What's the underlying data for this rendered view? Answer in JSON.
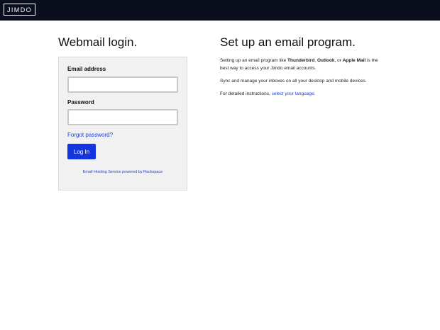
{
  "header": {
    "logo_text": "JIMDO",
    "background": "#0b0e1d"
  },
  "login": {
    "title": "Webmail login.",
    "email_label": "Email address",
    "email_value": "",
    "password_label": "Password",
    "password_value": "",
    "forgot_link": "Forgot password?",
    "login_button": "Log In",
    "powered_by": "Email Hosting Service powered by Rackspace",
    "button_color": "#1235e0",
    "link_color": "#1c3fd8"
  },
  "setup": {
    "title": "Set up an email program.",
    "p1_prefix": "Setting up an email program like ",
    "p1_app1": "Thunderbird",
    "p1_sep1": ", ",
    "p1_app2": "Outlook",
    "p1_sep2": ", or ",
    "p1_app3": "Apple Mail",
    "p1_suffix": " is the best way to access your Jimdo email accounts.",
    "p2": "Sync and manage your inboxes on all your desktop and mobile devices.",
    "p3_prefix": "For detailed instructions, ",
    "p3_link": "select your language",
    "p3_suffix": "."
  }
}
